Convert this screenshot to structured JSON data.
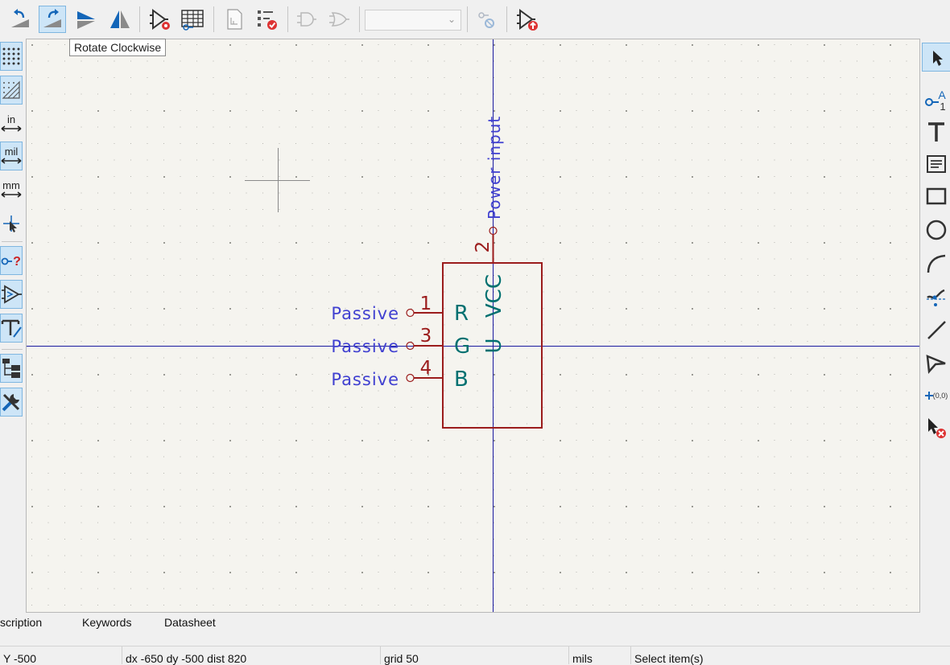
{
  "tooltip": "Rotate Clockwise",
  "toolbar": {
    "icons": [
      "rotate-ccw-icon",
      "rotate-cw-icon",
      "mirror-horizontal-icon",
      "mirror-vertical-icon",
      "symbol-properties-icon",
      "pin-table-icon",
      "datasheet-icon",
      "symbol-checker-icon",
      "and-gate-icon",
      "or-gate-icon",
      "unit-selector",
      "pin-sync-icon",
      "update-symbol-icon"
    ],
    "unit_combo_value": ""
  },
  "left_toolbar": [
    "grid-dots-icon",
    "grid-overrides-icon",
    "units-inch-icon",
    "units-mil-icon",
    "units-mm-icon",
    "cursor-full-crosshair-icon",
    "show-pin-types-icon",
    "show-pin-electrical-types-icon",
    "hidden-fields-icon",
    "hierarchy-panel-icon",
    "properties-panel-icon"
  ],
  "left_unit_labels": {
    "in": "in",
    "mil": "mil",
    "mm": "mm"
  },
  "right_toolbar": [
    "select-icon",
    "add-pin-icon",
    "add-text-icon",
    "add-textbox-icon",
    "add-rectangle-icon",
    "add-circle-icon",
    "add-arc-icon",
    "add-bezier-icon",
    "add-line-icon",
    "add-polygon-icon",
    "set-anchor-icon",
    "delete-icon"
  ],
  "symbol": {
    "power_pin": {
      "number": "2",
      "type": "Power input",
      "name": "VCC"
    },
    "pins": [
      {
        "number": "1",
        "type": "Passive",
        "name": "R"
      },
      {
        "number": "3",
        "type": "Passive",
        "name": "G"
      },
      {
        "number": "4",
        "type": "Passive",
        "name": "B"
      }
    ],
    "reference_text": "U"
  },
  "colors": {
    "body": "#9b1c1c",
    "pin_type": "#4040d0",
    "pin_name": "#007070",
    "axis": "#1a1aa0"
  },
  "lib_columns": {
    "description": "scription",
    "keywords": "Keywords",
    "datasheet": "Datasheet"
  },
  "status_bar": {
    "y": "Y -500",
    "delta": "dx -650  dy -500  dist 820",
    "grid": "grid 50",
    "units": "mils",
    "message": "Select item(s)"
  }
}
